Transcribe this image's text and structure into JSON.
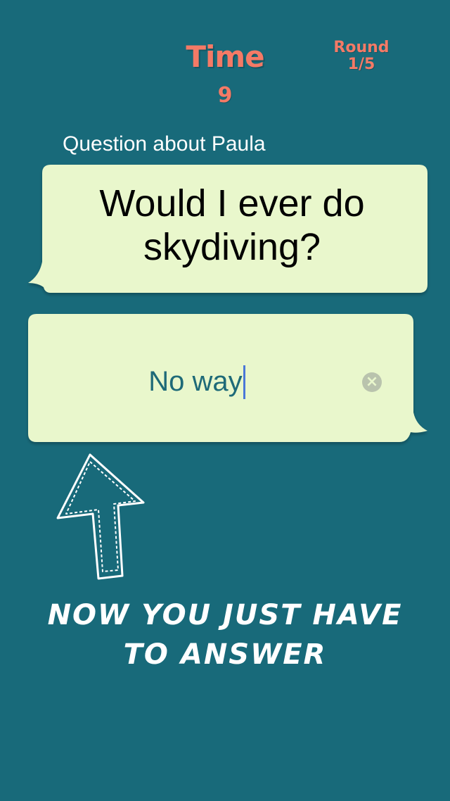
{
  "header": {
    "timer_label": "Time",
    "timer_value": "9",
    "round_label": "Round",
    "round_value": "1/5"
  },
  "question": {
    "caption": "Question about Paula",
    "line1": "Would I ever do",
    "line2": "skydiving?"
  },
  "answer": {
    "value": "No way",
    "clear_icon": "clear-icon"
  },
  "hint": {
    "line1": "NOW YOU JUST HAVE",
    "line2": "TO ANSWER",
    "arrow_icon": "arrow-up-icon"
  },
  "colors": {
    "background": "#186a7a",
    "accent": "#f47a66",
    "bubble": "#e9f7cc",
    "answer_text": "#1e6a78",
    "caret": "#4b78d8"
  }
}
